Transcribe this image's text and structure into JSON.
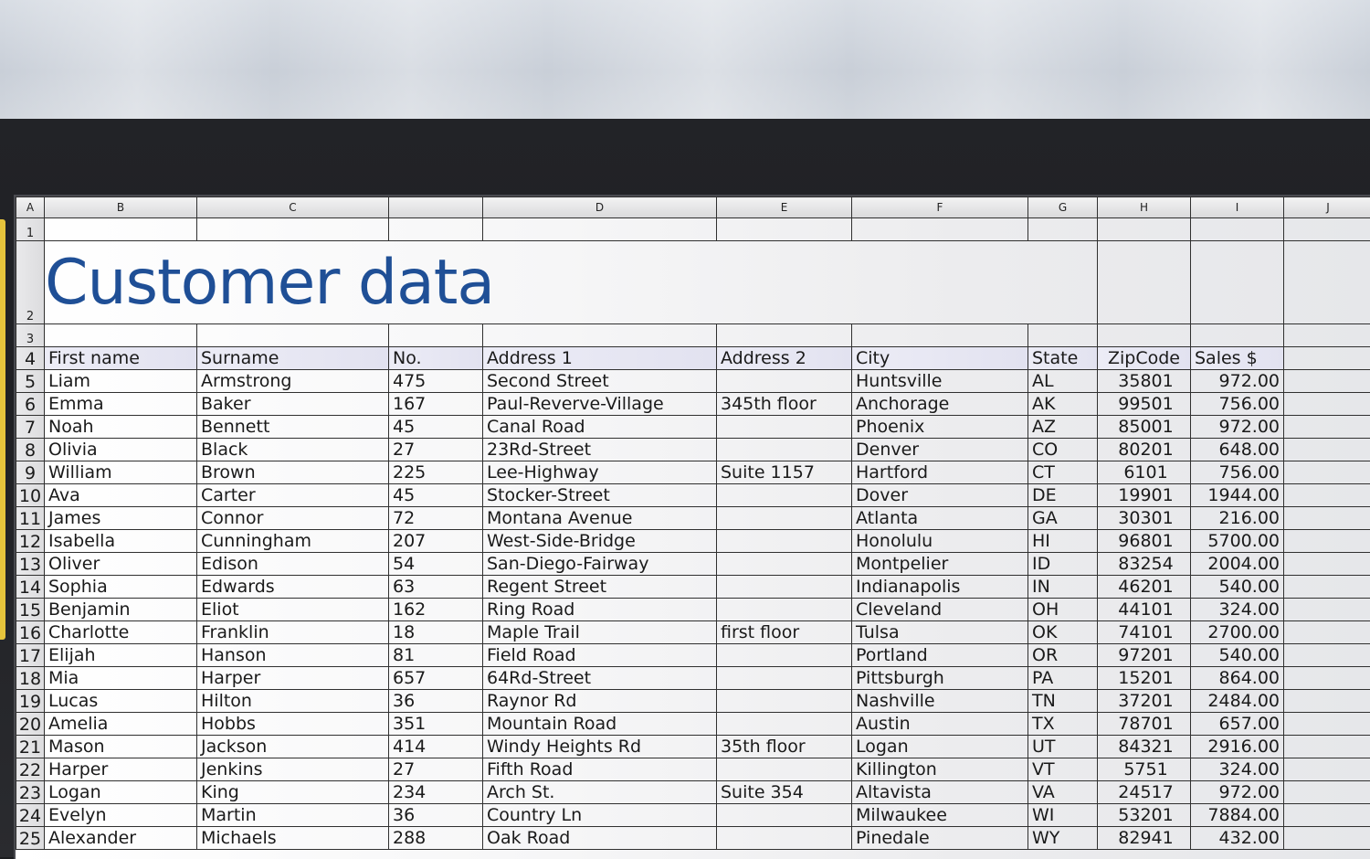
{
  "sheet": {
    "columns": [
      "A",
      "B",
      "C",
      "",
      "D",
      "E",
      "F",
      "G",
      "H",
      "I",
      "J"
    ],
    "title": "Customer data",
    "row_numbers": [
      "1",
      "2",
      "3",
      "4",
      "5",
      "6",
      "7",
      "8",
      "9",
      "10",
      "11",
      "12",
      "13",
      "14",
      "15",
      "16",
      "17",
      "18",
      "19",
      "20",
      "21",
      "22",
      "23",
      "24",
      "25"
    ],
    "headers": {
      "first_name": "First name",
      "surname": "Surname",
      "no": "No.",
      "address1": "Address 1",
      "address2": "Address 2",
      "city": "City",
      "state": "State",
      "zip": "ZipCode",
      "sales": "Sales $"
    },
    "rows": [
      [
        "Liam",
        "Armstrong",
        "475",
        "Second Street",
        "",
        "Huntsville",
        "AL",
        "35801",
        "972.00"
      ],
      [
        "Emma",
        "Baker",
        "167",
        "Paul-Reverve-Village",
        "345th floor",
        "Anchorage",
        "AK",
        "99501",
        "756.00"
      ],
      [
        "Noah",
        "Bennett",
        "45",
        "Canal Road",
        "",
        "Phoenix",
        "AZ",
        "85001",
        "972.00"
      ],
      [
        "Olivia",
        "Black",
        "27",
        "23Rd-Street",
        "",
        "Denver",
        "CO",
        "80201",
        "648.00"
      ],
      [
        "William",
        "Brown",
        "225",
        "Lee-Highway",
        "Suite 1157",
        "Hartford",
        "CT",
        "6101",
        "756.00"
      ],
      [
        "Ava",
        "Carter",
        "45",
        "Stocker-Street",
        "",
        "Dover",
        "DE",
        "19901",
        "1944.00"
      ],
      [
        "James",
        "Connor",
        "72",
        "Montana Avenue",
        "",
        "Atlanta",
        "GA",
        "30301",
        "216.00"
      ],
      [
        "Isabella",
        "Cunningham",
        "207",
        "West-Side-Bridge",
        "",
        "Honolulu",
        "HI",
        "96801",
        "5700.00"
      ],
      [
        "Oliver",
        "Edison",
        "54",
        "San-Diego-Fairway",
        "",
        "Montpelier",
        "ID",
        "83254",
        "2004.00"
      ],
      [
        "Sophia",
        "Edwards",
        "63",
        "Regent Street",
        "",
        "Indianapolis",
        "IN",
        "46201",
        "540.00"
      ],
      [
        "Benjamin",
        "Eliot",
        "162",
        "Ring Road",
        "",
        "Cleveland",
        "OH",
        "44101",
        "324.00"
      ],
      [
        "Charlotte",
        "Franklin",
        "18",
        "Maple Trail",
        "first floor",
        "Tulsa",
        "OK",
        "74101",
        "2700.00"
      ],
      [
        "Elijah",
        "Hanson",
        "81",
        "Field Road",
        "",
        "Portland",
        "OR",
        "97201",
        "540.00"
      ],
      [
        "Mia",
        "Harper",
        "657",
        "64Rd-Street",
        "",
        "Pittsburgh",
        "PA",
        "15201",
        "864.00"
      ],
      [
        "Lucas",
        "Hilton",
        "36",
        "Raynor Rd",
        "",
        "Nashville",
        "TN",
        "37201",
        "2484.00"
      ],
      [
        "Amelia",
        "Hobbs",
        "351",
        "Mountain Road",
        "",
        "Austin",
        "TX",
        "78701",
        "657.00"
      ],
      [
        "Mason",
        "Jackson",
        "414",
        "Windy Heights Rd",
        "35th floor",
        "Logan",
        "UT",
        "84321",
        "2916.00"
      ],
      [
        "Harper",
        "Jenkins",
        "27",
        "Fifth Road",
        "",
        "Killington",
        "VT",
        "5751",
        "324.00"
      ],
      [
        "Logan",
        "King",
        "234",
        "Arch St.",
        "Suite 354",
        "Altavista",
        "VA",
        "24517",
        "972.00"
      ],
      [
        "Evelyn",
        "Martin",
        "36",
        "Country Ln",
        "",
        "Milwaukee",
        "WI",
        "53201",
        "7884.00"
      ],
      [
        "Alexander",
        "Michaels",
        "288",
        "Oak Road",
        "",
        "Pinedale",
        "WY",
        "82941",
        "432.00"
      ]
    ]
  },
  "colors": {
    "title": "#1f4f96",
    "header_fill": "#e6e6f2",
    "frame_accent": "#e6c43c"
  }
}
